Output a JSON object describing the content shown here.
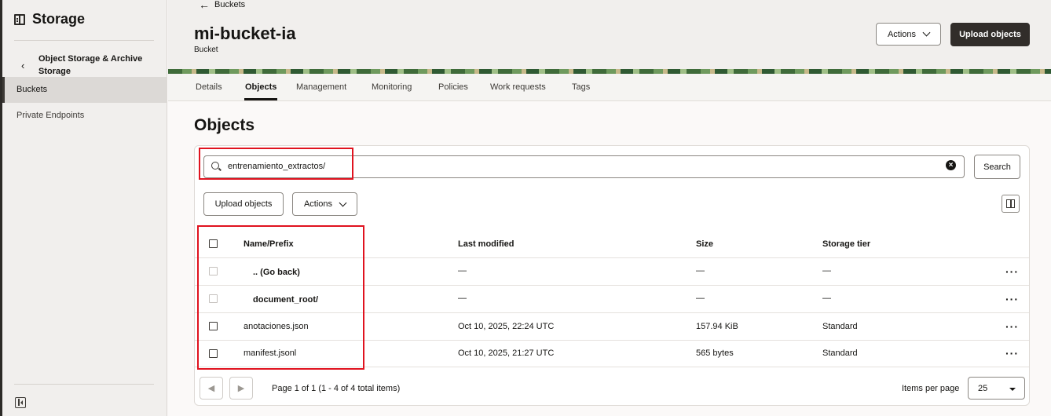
{
  "sidebar": {
    "title": "Storage",
    "parent": "Object Storage & Archive Storage",
    "items": [
      {
        "label": "Buckets",
        "active": true
      },
      {
        "label": "Private Endpoints",
        "active": false
      }
    ]
  },
  "header": {
    "back_label": "Buckets",
    "title": "mi-bucket-ia",
    "subtitle": "Bucket",
    "actions_label": "Actions",
    "upload_label": "Upload objects"
  },
  "tabs": [
    "Details",
    "Objects",
    "Management",
    "Monitoring",
    "Policies",
    "Work requests",
    "Tags"
  ],
  "active_tab": "Objects",
  "objects": {
    "heading": "Objects",
    "search_value": "entrenamiento_extractos/",
    "search_button": "Search",
    "upload_label": "Upload objects",
    "actions_label": "Actions",
    "columns": [
      "Name/Prefix",
      "Last modified",
      "Size",
      "Storage tier"
    ],
    "rows": [
      {
        "name": ".. (Go back)",
        "modified": "—",
        "size": "—",
        "tier": "—",
        "folder": true
      },
      {
        "name": "document_root/",
        "modified": "—",
        "size": "—",
        "tier": "—",
        "folder": true
      },
      {
        "name": "anotaciones.json",
        "modified": "Oct 10, 2025, 22:24 UTC",
        "size": "157.94 KiB",
        "tier": "Standard",
        "folder": false
      },
      {
        "name": "manifest.jsonl",
        "modified": "Oct 10, 2025, 21:27 UTC",
        "size": "565 bytes",
        "tier": "Standard",
        "folder": false
      }
    ],
    "more_glyph": "···",
    "pager_text": "Page 1 of 1 (1 - 4 of 4 total items)",
    "items_per_page_label": "Items per page",
    "items_per_page_value": "25"
  },
  "colors": {
    "highlight": "#e0131f",
    "primary_button": "#312d2a"
  }
}
